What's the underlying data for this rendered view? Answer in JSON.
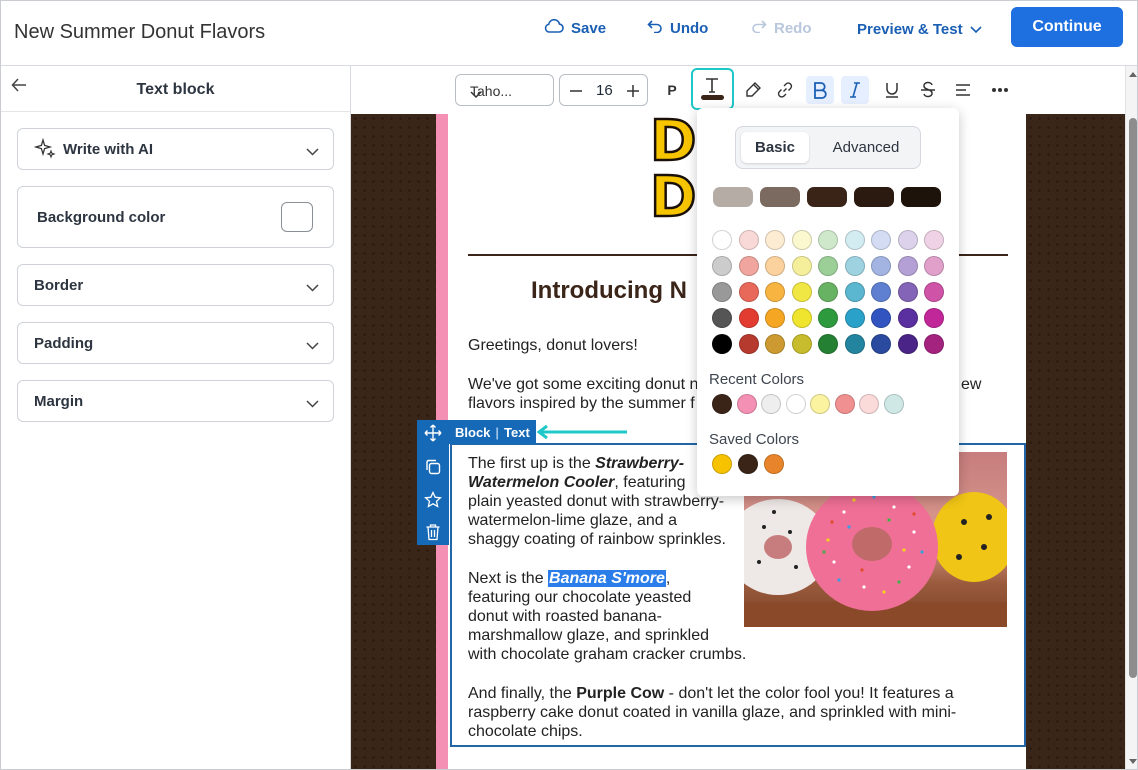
{
  "header": {
    "title": "New Summer Donut Flavors",
    "save_label": "Save",
    "undo_label": "Undo",
    "redo_label": "Redo",
    "preview_label": "Preview & Test",
    "continue_label": "Continue"
  },
  "left_panel": {
    "title": "Text block",
    "items": [
      {
        "label": "Write with AI"
      },
      {
        "label": "Background color"
      },
      {
        "label": "Border"
      },
      {
        "label": "Padding"
      },
      {
        "label": "Margin"
      }
    ]
  },
  "toolbar": {
    "font_family": "Taho...",
    "font_size": "16",
    "paragraph_label": "P"
  },
  "email": {
    "logo_lines": [
      "DO",
      "DO"
    ],
    "headline": "Introducing N",
    "greeting": "Greetings, donut lovers!",
    "intro_lines": [
      "We've got some exciting donut n",
      "flavors inspired by the summer f"
    ],
    "intro_tail": "ew",
    "block_tag": {
      "block": "Block",
      "text": "Text"
    },
    "p1": {
      "l1_a": "The first up is the ",
      "l1_b": "Strawberry-",
      "l2_a": "Watermelon Cooler",
      "l2_b": ", featuring",
      "l3": "plain yeasted donut with strawberry-",
      "l4": "watermelon-lime glaze, and a",
      "l5": "shaggy coating of rainbow sprinkles."
    },
    "p2": {
      "l1_a": "Next is the ",
      "l1_b": "Banana S'more",
      "l1_c": ",",
      "l2": "featuring our chocolate yeasted",
      "l3": "donut with roasted banana-",
      "l4": "marshmallow glaze, and sprinkled",
      "l5": "with chocolate graham cracker crumbs."
    },
    "p3": {
      "l1_a": "And finally, the ",
      "l1_b": "Purple Cow",
      "l1_c": " - don't let the color fool you! It features a",
      "l2": "raspberry cake donut coated in vanilla glaze, and sprinkled with mini-",
      "l3": "chocolate chips."
    }
  },
  "color_picker": {
    "tabs": [
      "Basic",
      "Advanced"
    ],
    "selected_tab": "Basic",
    "theme_colors": [
      "#b5aca6",
      "#7a6a60",
      "#3a2418",
      "#2a1a10",
      "#1e130b"
    ],
    "grid": [
      [
        "#ffffff",
        "#f9d9d7",
        "#fdebd2",
        "#fbf7cf",
        "#cfe8cb",
        "#d3ecf2",
        "#d3dcf3",
        "#dcd2eb",
        "#f0d2e6"
      ],
      [
        "#cccccc",
        "#f0a59e",
        "#fbd29e",
        "#f5ef9c",
        "#9ccf98",
        "#9ed2e1",
        "#a3b4e3",
        "#b4a0d5",
        "#e0a0ca"
      ],
      [
        "#999999",
        "#e8685a",
        "#f8b441",
        "#f1e744",
        "#68b363",
        "#5bb6cf",
        "#5f7fd1",
        "#8364b6",
        "#cf54a7"
      ],
      [
        "#555555",
        "#e23c30",
        "#f5a623",
        "#efe42e",
        "#2e9a3e",
        "#2aa1c8",
        "#3154c0",
        "#5a2fa0",
        "#c2279a"
      ],
      [
        "#000000",
        "#b73a2f",
        "#cc9a30",
        "#c7bc2b",
        "#248033",
        "#23849f",
        "#2a4aa0",
        "#4a2486",
        "#a3237f"
      ]
    ],
    "recent_label": "Recent Colors",
    "recent": [
      "#3a2418",
      "#f390b4",
      "#eeeeee",
      "#ffffff",
      "#fbf3a0",
      "#f09090",
      "#fbdada",
      "#cfe8e6"
    ],
    "saved_label": "Saved Colors",
    "saved": [
      "#f7c200",
      "#3a2418",
      "#e8852a"
    ]
  }
}
